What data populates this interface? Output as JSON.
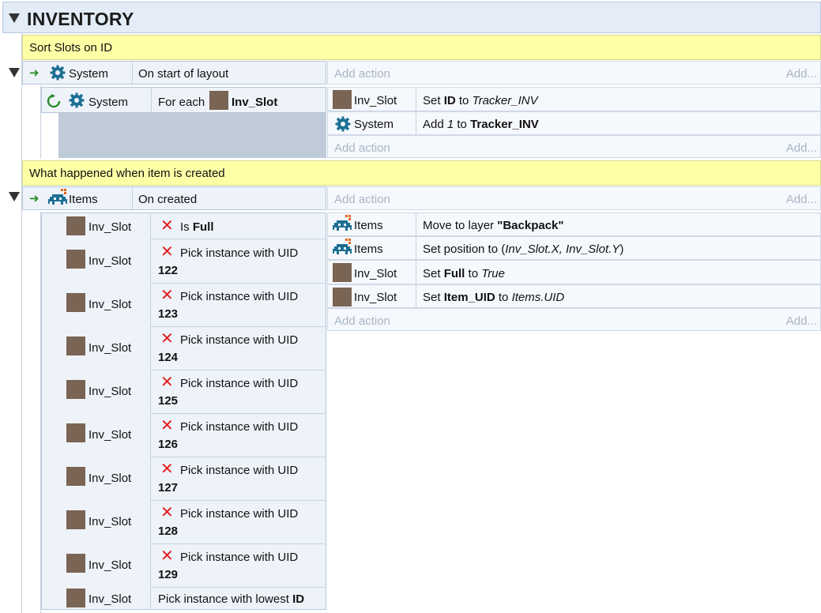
{
  "group": {
    "title": "INVENTORY"
  },
  "events": [
    {
      "comment": "Sort Slots on ID",
      "condition": {
        "object": "System",
        "text": "On start of layout"
      },
      "add_action": "Add action",
      "add_more": "Add...",
      "sub_event": {
        "condition": {
          "object": "System",
          "text_prefix": "For each",
          "target": "Inv_Slot"
        },
        "actions": [
          {
            "object": "Inv_Slot",
            "prefix": "Set ",
            "key": "ID",
            "mid": " to ",
            "value": "Tracker_INV"
          },
          {
            "object": "System",
            "prefix": "Add ",
            "key": "1",
            "mid": " to ",
            "value": "Tracker_INV"
          }
        ],
        "add_action": "Add action",
        "add_more": "Add..."
      }
    },
    {
      "comment": "What happened when item is created",
      "condition": {
        "object": "Items",
        "text": "On created"
      },
      "add_action": "Add action",
      "add_more": "Add...",
      "sub_event": {
        "is_full": {
          "object": "Inv_Slot",
          "prefix": "Is ",
          "key": "Full"
        },
        "pick_label": "Pick instance with UID",
        "picks": [
          {
            "object": "Inv_Slot",
            "uid": "122"
          },
          {
            "object": "Inv_Slot",
            "uid": "123"
          },
          {
            "object": "Inv_Slot",
            "uid": "124"
          },
          {
            "object": "Inv_Slot",
            "uid": "125"
          },
          {
            "object": "Inv_Slot",
            "uid": "126"
          },
          {
            "object": "Inv_Slot",
            "uid": "127"
          },
          {
            "object": "Inv_Slot",
            "uid": "128"
          },
          {
            "object": "Inv_Slot",
            "uid": "129"
          }
        ],
        "lowest": {
          "object": "Inv_Slot",
          "prefix": "Pick instance with lowest ",
          "key": "ID"
        },
        "actions": [
          {
            "object": "Items",
            "prefix": "Move to layer ",
            "key": "\"Backpack\""
          },
          {
            "object": "Items",
            "prefix": "Set position to (",
            "value": "Inv_Slot.X, Inv_Slot.Y",
            "suffix": ")"
          },
          {
            "object": "Inv_Slot",
            "prefix": "Set ",
            "key": "Full",
            "mid": " to ",
            "value": "True"
          },
          {
            "object": "Inv_Slot",
            "prefix": "Set ",
            "key": "Item_UID",
            "mid": " to ",
            "value": "Items.UID"
          }
        ],
        "add_action": "Add action",
        "add_more": "Add..."
      }
    }
  ]
}
